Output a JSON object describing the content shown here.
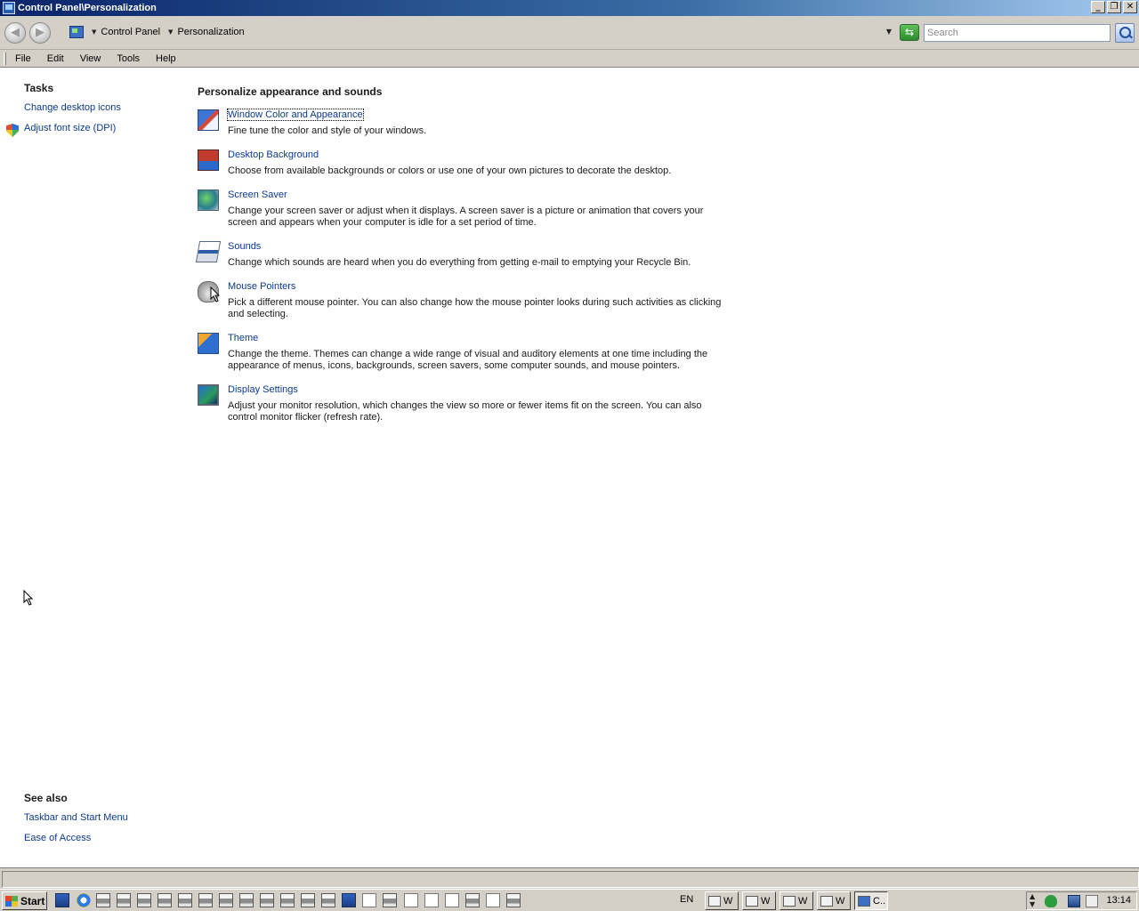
{
  "window": {
    "title": "Control Panel\\Personalization"
  },
  "caption_buttons": {
    "minimize": "_",
    "restore": "❐",
    "close": "✕"
  },
  "address": {
    "back_glyph": "◀",
    "forward_glyph": "▶",
    "crumbs": [
      "Control Panel",
      "Personalization"
    ],
    "search_placeholder": "Search"
  },
  "menu": [
    "File",
    "Edit",
    "View",
    "Tools",
    "Help"
  ],
  "left_pane": {
    "tasks_heading": "Tasks",
    "tasks": [
      "Change desktop icons",
      "Adjust font size (DPI)"
    ],
    "see_also_heading": "See also",
    "see_also": [
      "Taskbar and Start Menu",
      "Ease of Access"
    ]
  },
  "main": {
    "heading": "Personalize appearance and sounds",
    "items": [
      {
        "icon": "window-color-icon",
        "title": "Window Color and Appearance",
        "desc": "Fine tune the color and style of your windows."
      },
      {
        "icon": "desktop-background-icon",
        "title": "Desktop Background",
        "desc": "Choose from available backgrounds or colors or use one of your own pictures to decorate the desktop."
      },
      {
        "icon": "screen-saver-icon",
        "title": "Screen Saver",
        "desc": "Change your screen saver or adjust when it displays. A screen saver is a picture or animation that covers your screen and appears when your computer is idle for a set period of time."
      },
      {
        "icon": "sounds-icon",
        "title": "Sounds",
        "desc": "Change which sounds are heard when you do everything from getting e-mail to emptying your Recycle Bin."
      },
      {
        "icon": "mouse-pointers-icon",
        "title": "Mouse Pointers",
        "desc": "Pick a different mouse pointer. You can also change how the mouse pointer looks during such activities as clicking and selecting."
      },
      {
        "icon": "theme-icon",
        "title": "Theme",
        "desc": "Change the theme. Themes can change a wide range of visual and auditory elements at one time including the appearance of menus, icons, backgrounds, screen savers, some computer sounds, and mouse pointers."
      },
      {
        "icon": "display-settings-icon",
        "title": "Display Settings",
        "desc": "Adjust your monitor resolution, which changes the view so more or fewer items fit on the screen. You can also control monitor flicker (refresh rate)."
      }
    ]
  },
  "taskbar": {
    "start_label": "Start",
    "language": "EN",
    "buttons": [
      "W",
      "W",
      "W",
      "W",
      "C.."
    ],
    "clock": "13:14"
  }
}
